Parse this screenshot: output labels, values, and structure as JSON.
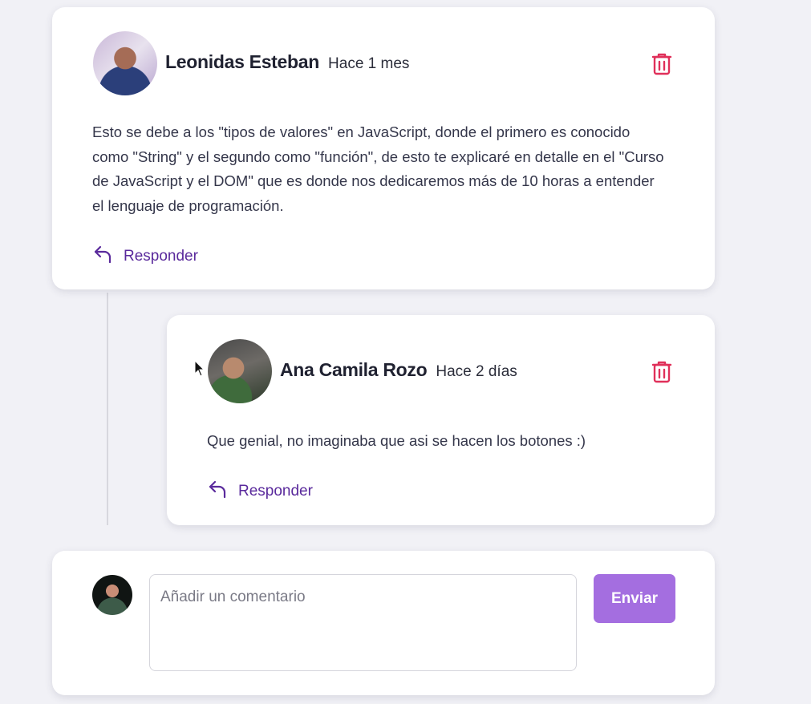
{
  "colors": {
    "accent_purple": "#5a2a9c",
    "button_purple": "#a46ee0",
    "trash_red": "#e0305a",
    "background": "#f1f1f6"
  },
  "comments": [
    {
      "author": "Leonidas Esteban",
      "time": "Hace 1 mes",
      "text": "Esto se debe a los \"tipos de valores\" en JavaScript, donde el primero es conocido como \"String\" y el segundo como \"función\", de esto te explicaré en detalle en el \"Curso de JavaScript y el DOM\" que es donde nos dedicaremos más de 10 horas a entender el lenguaje de programación.",
      "reply_label": "Responder",
      "icons": [
        "avatar",
        "trash-icon",
        "reply-arrow-icon"
      ]
    },
    {
      "author": "Ana Camila Rozo",
      "time": "Hace 2 días",
      "text": "Que genial, no imaginaba que asi se hacen los botones :)",
      "reply_label": "Responder",
      "icons": [
        "avatar",
        "trash-icon",
        "reply-arrow-icon"
      ]
    }
  ],
  "new_comment": {
    "placeholder": "Añadir un comentario",
    "value": "",
    "submit_label": "Enviar"
  }
}
